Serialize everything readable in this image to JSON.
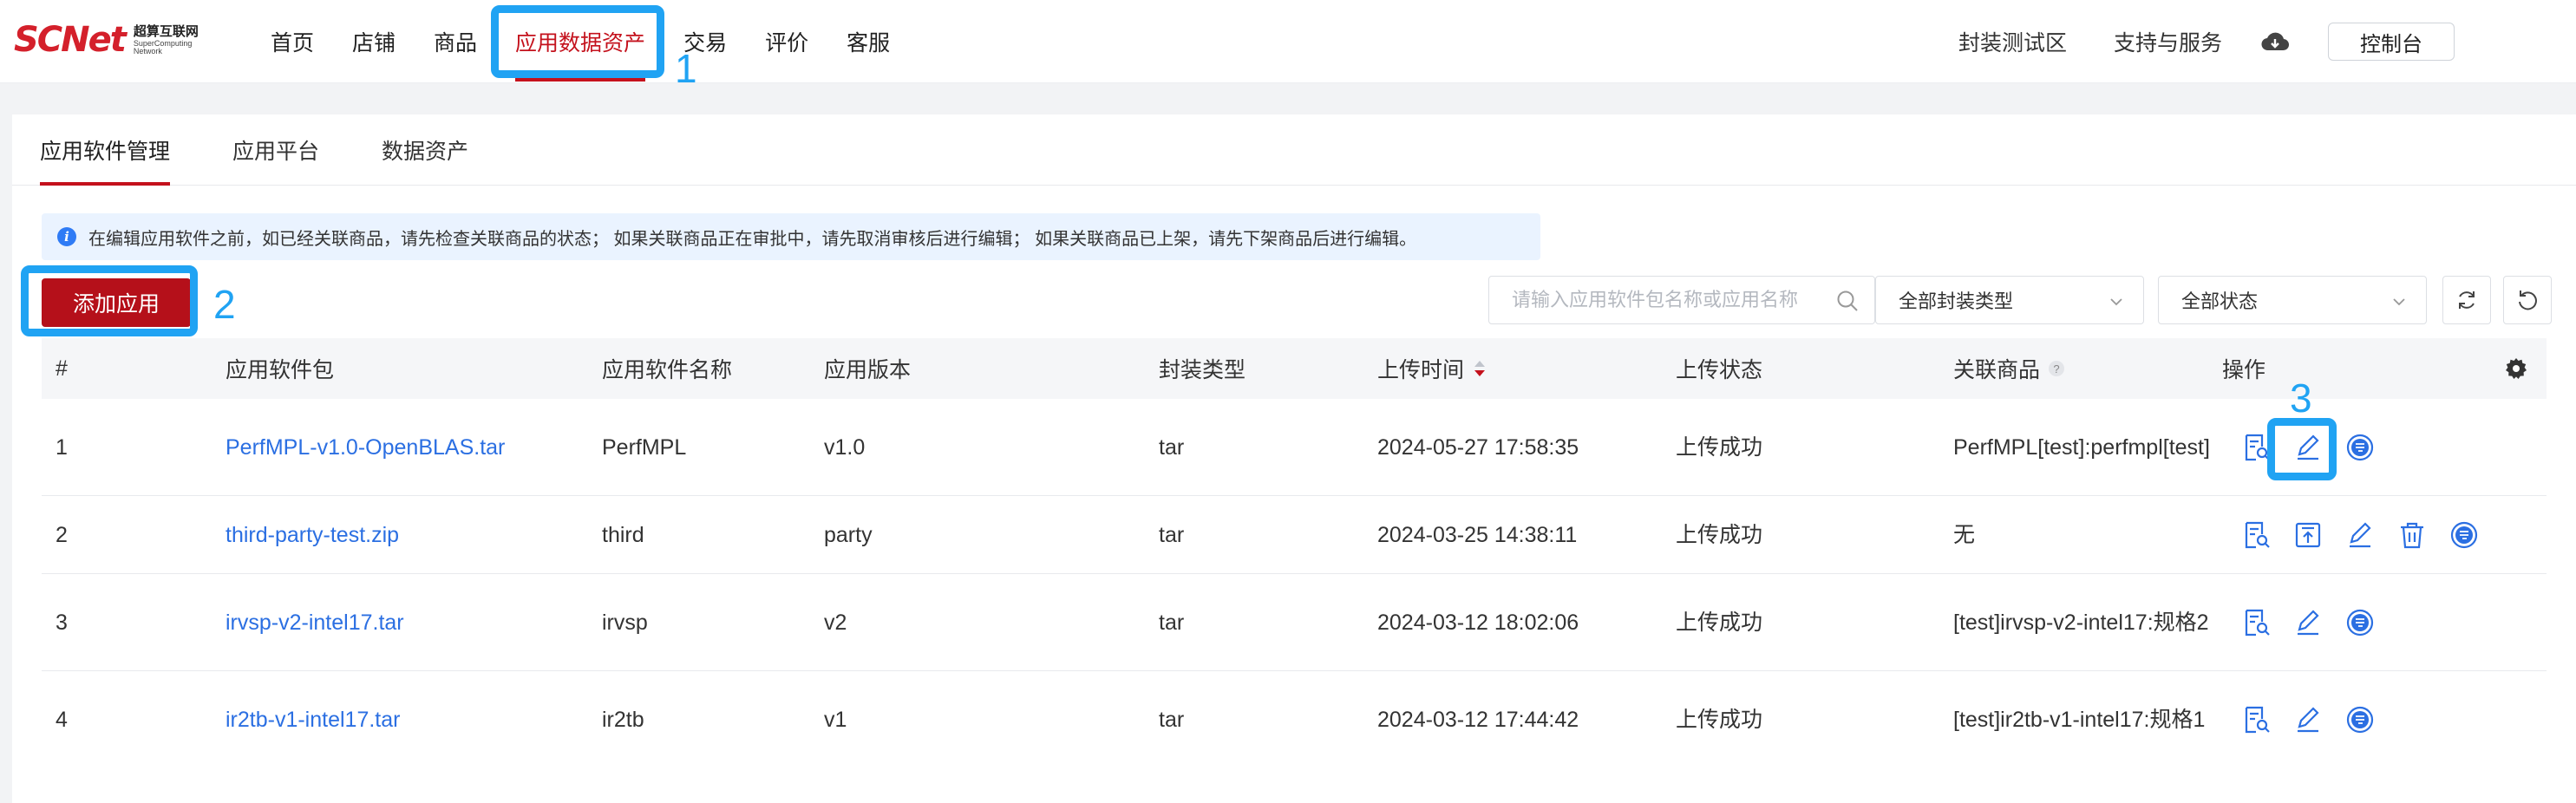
{
  "brand": {
    "logo_main": "SCNet",
    "logo_cn": "超算互联网",
    "logo_en": "SuperComputing Network"
  },
  "nav": {
    "items": [
      {
        "label": "首页"
      },
      {
        "label": "店铺"
      },
      {
        "label": "商品"
      },
      {
        "label": "应用数据资产"
      },
      {
        "label": "交易"
      },
      {
        "label": "评价"
      },
      {
        "label": "客服"
      }
    ],
    "right": {
      "sandbox": "封装测试区",
      "support": "支持与服务",
      "console": "控制台"
    }
  },
  "annotations": {
    "n1": "1",
    "n2": "2",
    "n3": "3"
  },
  "tabs": [
    {
      "label": "应用软件管理"
    },
    {
      "label": "应用平台"
    },
    {
      "label": "数据资产"
    }
  ],
  "notice": "在编辑应用软件之前，如已经关联商品，请先检查关联商品的状态； 如果关联商品正在审批中，请先取消审核后进行编辑； 如果关联商品已上架，请先下架商品后进行编辑。",
  "toolbar": {
    "add_label": "添加应用",
    "search_placeholder": "请输入应用软件包名称或应用名称",
    "filter_type": "全部封装类型",
    "filter_status": "全部状态"
  },
  "table": {
    "headers": {
      "idx": "#",
      "pkg": "应用软件包",
      "name": "应用软件名称",
      "version": "应用版本",
      "type": "封装类型",
      "time": "上传时间",
      "status": "上传状态",
      "product": "关联商品",
      "ops": "操作"
    },
    "rows": [
      {
        "idx": "1",
        "pkg": "PerfMPL-v1.0-OpenBLAS.tar",
        "name": "PerfMPL",
        "version": "v1.0",
        "type": "tar",
        "time": "2024-05-27 17:58:35",
        "status": "上传成功",
        "product": "PerfMPL[test]:perfmpl[test]"
      },
      {
        "idx": "2",
        "pkg": "third-party-test.zip",
        "name": "third",
        "version": "party",
        "type": "tar",
        "time": "2024-03-25 14:38:11",
        "status": "上传成功",
        "product": "无"
      },
      {
        "idx": "3",
        "pkg": "irvsp-v2-intel17.tar",
        "name": "irvsp",
        "version": "v2",
        "type": "tar",
        "time": "2024-03-12 18:02:06",
        "status": "上传成功",
        "product": "[test]irvsp-v2-intel17:规格2"
      },
      {
        "idx": "4",
        "pkg": "ir2tb-v1-intel17.tar",
        "name": "ir2tb",
        "version": "v1",
        "type": "tar",
        "time": "2024-03-12 17:44:42",
        "status": "上传成功",
        "product": "[test]ir2tb-v1-intel17:规格1"
      }
    ]
  },
  "colors": {
    "brand_red": "#c4111c",
    "link_blue": "#2b6fe2",
    "annotation_blue": "#20a3f3"
  }
}
